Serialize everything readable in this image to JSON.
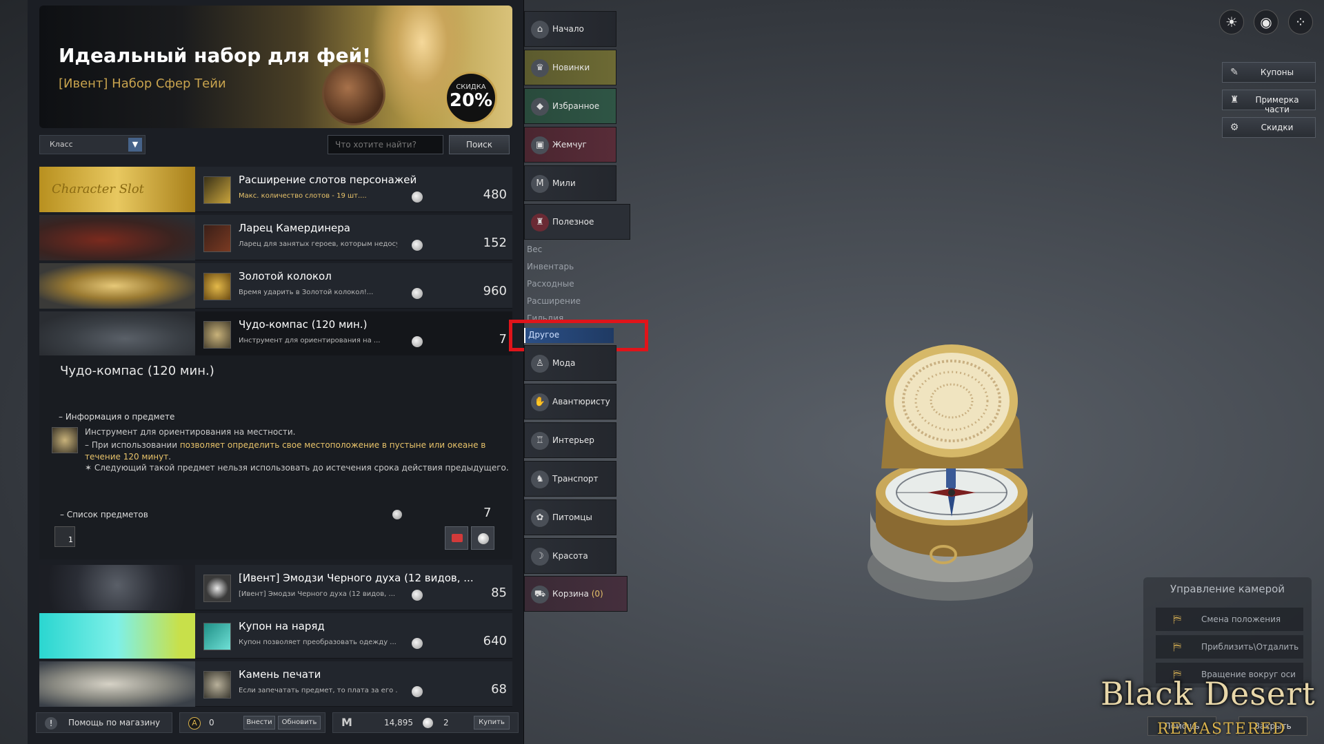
{
  "banner": {
    "title": "Идеальный набор для фей!",
    "subtitle": "[Ивент] Набор Сфер Тейи",
    "discount_label": "СКИДКА",
    "discount_value": "20%"
  },
  "search": {
    "class_select": "Класс",
    "placeholder": "Что хотите найти?",
    "button": "Поиск"
  },
  "items": [
    {
      "name": "Расширение слотов персонажей",
      "desc": "Макс. количество слотов - 19 шт....",
      "price": "480",
      "thumb_text": "Character Slot"
    },
    {
      "name": "Ларец Камердинера",
      "desc": "Ларец для занятых героев, которым недосуг...",
      "price": "152"
    },
    {
      "name": "Золотой колокол",
      "desc": "Время ударить в Золотой колокол!...",
      "price": "960"
    },
    {
      "name": "Чудо-компас (120 мин.)",
      "desc": "Инструмент для ориентирования на ...",
      "price": "7"
    },
    {
      "name": "[Ивент] Эмодзи Черного духа (12 видов, ...",
      "desc": "[Ивент] Эмодзи Черного духа (12 видов, ...",
      "price": "85"
    },
    {
      "name": "Купон на наряд",
      "desc": "Купон позволяет преобразовать одежду ...",
      "price": "640"
    },
    {
      "name": "Камень печати",
      "desc": "Если запечатать предмет, то плата за его ...",
      "price": "68"
    }
  ],
  "detail": {
    "title": "Чудо-компас (120 мин.)",
    "info_heading": "– Информация о предмете",
    "line1": "Инструмент для ориентирования на местности.",
    "line2_prefix": "– При использовании ",
    "line2_highlight": "позволяет определить свое местоположение в пустыне или океане в течение 120 минут",
    "line2_suffix": ".",
    "line3": "✶ Следующий такой предмет нельзя использовать до истечения срока действия предыдущего.",
    "list_heading": "– Список предметов",
    "list_count": "7",
    "list_item_qty": "1"
  },
  "bottom": {
    "help": "Помощь по магазину",
    "points_value": "0",
    "deposit": "Внести",
    "refresh": "Обновить",
    "silver_value": "14,895",
    "pearl_value": "2",
    "buy": "Купить"
  },
  "nav": {
    "items": [
      {
        "label": "Начало",
        "icon": "home-icon"
      },
      {
        "label": "Новинки",
        "icon": "trophy-icon"
      },
      {
        "label": "Избранное",
        "icon": "star-diamond-icon"
      },
      {
        "label": "Жемчуг",
        "icon": "chest-icon"
      },
      {
        "label": "Мили",
        "icon": "miles-icon"
      },
      {
        "label": "Полезное",
        "icon": "potion-icon"
      }
    ],
    "sub_items": [
      "Вес",
      "Инвентарь",
      "Расходные",
      "Расширение",
      "Гильдия",
      "Другое"
    ],
    "items2": [
      {
        "label": "Мода",
        "icon": "outfit-icon"
      },
      {
        "label": "Авантюристу",
        "icon": "thumbs-up-icon"
      },
      {
        "label": "Интерьер",
        "icon": "furniture-icon"
      },
      {
        "label": "Транспорт",
        "icon": "horse-icon"
      },
      {
        "label": "Питомцы",
        "icon": "paw-icon"
      },
      {
        "label": "Красота",
        "icon": "beauty-icon"
      }
    ],
    "cart_label": "Корзина",
    "cart_count": "(0)"
  },
  "side": {
    "coupons": "Купоны",
    "try_on": "Примерка части",
    "discounts": "Скидки"
  },
  "camera": {
    "title": "Управление камерой",
    "move": "Смена положения",
    "zoom": "Приблизить\\Отдалить",
    "rotate": "Вращение вокруг оси"
  },
  "footer": {
    "help": "Помощь",
    "close": "Закрыть"
  },
  "logo": {
    "main": "Black Desert",
    "sub": "REMASTERED"
  },
  "colors": {
    "accent_red": "#e0141a",
    "selected_sub": "#2b4f86",
    "gold": "#d9b24c"
  }
}
